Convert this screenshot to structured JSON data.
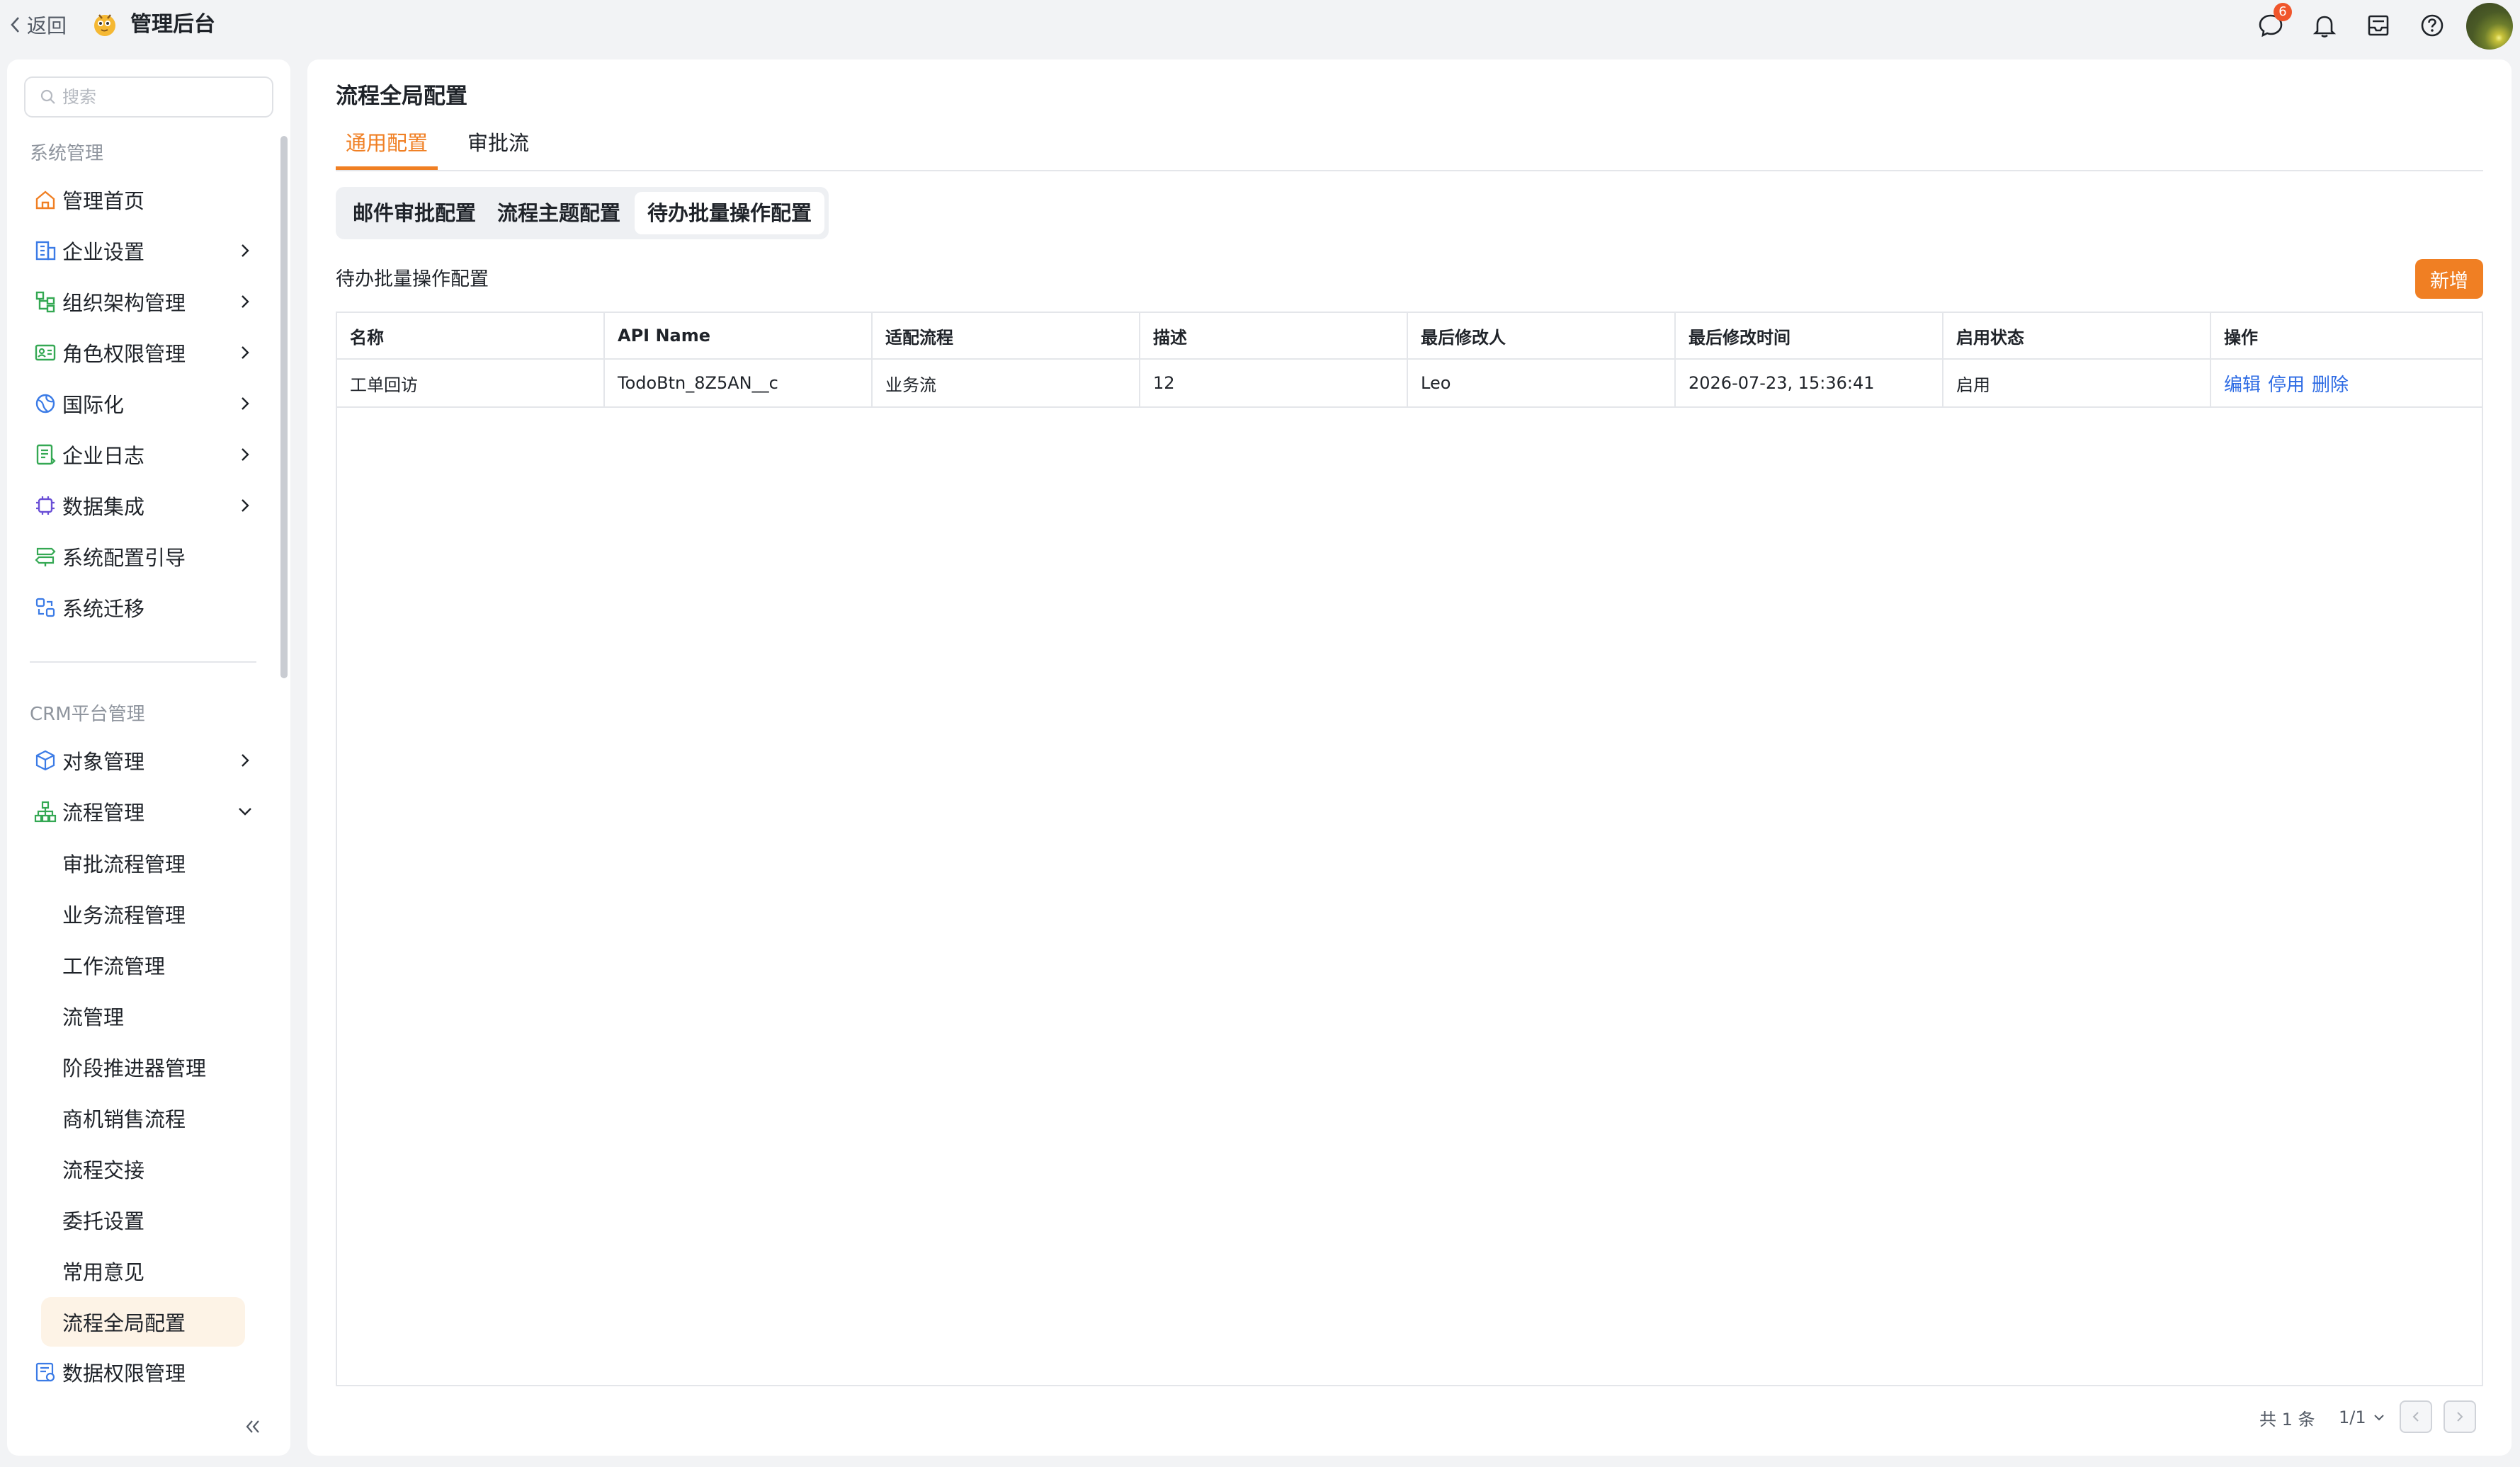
{
  "topbar": {
    "back_label": "返回",
    "app_title": "管理后台",
    "message_count": "6",
    "icons": [
      "chat-icon",
      "bell-icon",
      "inbox-icon",
      "help-icon"
    ]
  },
  "sidebar": {
    "search_placeholder": "搜索",
    "group1_label": "系统管理",
    "group1_items": [
      {
        "label": "管理首页",
        "icon": "home-icon"
      },
      {
        "label": "企业设置",
        "icon": "building-icon"
      },
      {
        "label": "组织架构管理",
        "icon": "org-icon"
      },
      {
        "label": "角色权限管理",
        "icon": "id-card-icon"
      },
      {
        "label": "国际化",
        "icon": "globe-icon"
      },
      {
        "label": "企业日志",
        "icon": "log-icon"
      },
      {
        "label": "数据集成",
        "icon": "chip-icon"
      },
      {
        "label": "系统配置引导",
        "icon": "signpost-icon"
      },
      {
        "label": "系统迁移",
        "icon": "migrate-icon"
      }
    ],
    "group2_label": "CRM平台管理",
    "group2_items": [
      {
        "label": "对象管理",
        "icon": "cube-icon"
      },
      {
        "label": "流程管理",
        "icon": "flow-icon"
      }
    ],
    "flow_sub_items": [
      "审批流程管理",
      "业务流程管理",
      "工作流管理",
      "流管理",
      "阶段推进器管理",
      "商机销售流程",
      "流程交接",
      "委托设置",
      "常用意见",
      "流程全局配置"
    ],
    "last_item": {
      "label": "数据权限管理",
      "icon": "data-lock-icon"
    }
  },
  "main": {
    "page_title": "流程全局配置",
    "tabs": [
      "通用配置",
      "审批流"
    ],
    "active_tab": "通用配置",
    "segments": [
      "邮件审批配置",
      "流程主题配置",
      "待办批量操作配置"
    ],
    "active_segment": "待办批量操作配置",
    "section_label": "待办批量操作配置",
    "add_button": "新增",
    "table": {
      "columns": [
        "名称",
        "API Name",
        "适配流程",
        "描述",
        "最后修改人",
        "最后修改时间",
        "启用状态",
        "操作"
      ],
      "rows": [
        [
          "工单回访",
          "TodoBtn_8Z5AN__c",
          "业务流",
          "12",
          "Leo",
          "2026-07-23, 15:36:41",
          "启用"
        ]
      ],
      "row_actions": [
        "编辑",
        "停用",
        "删除"
      ]
    },
    "pagination": {
      "total": "共 1 条",
      "page": "1/1"
    }
  },
  "colors": {
    "accent": "#f07f23",
    "link": "#2d6be4",
    "active_bg": "#fdf3e6"
  }
}
